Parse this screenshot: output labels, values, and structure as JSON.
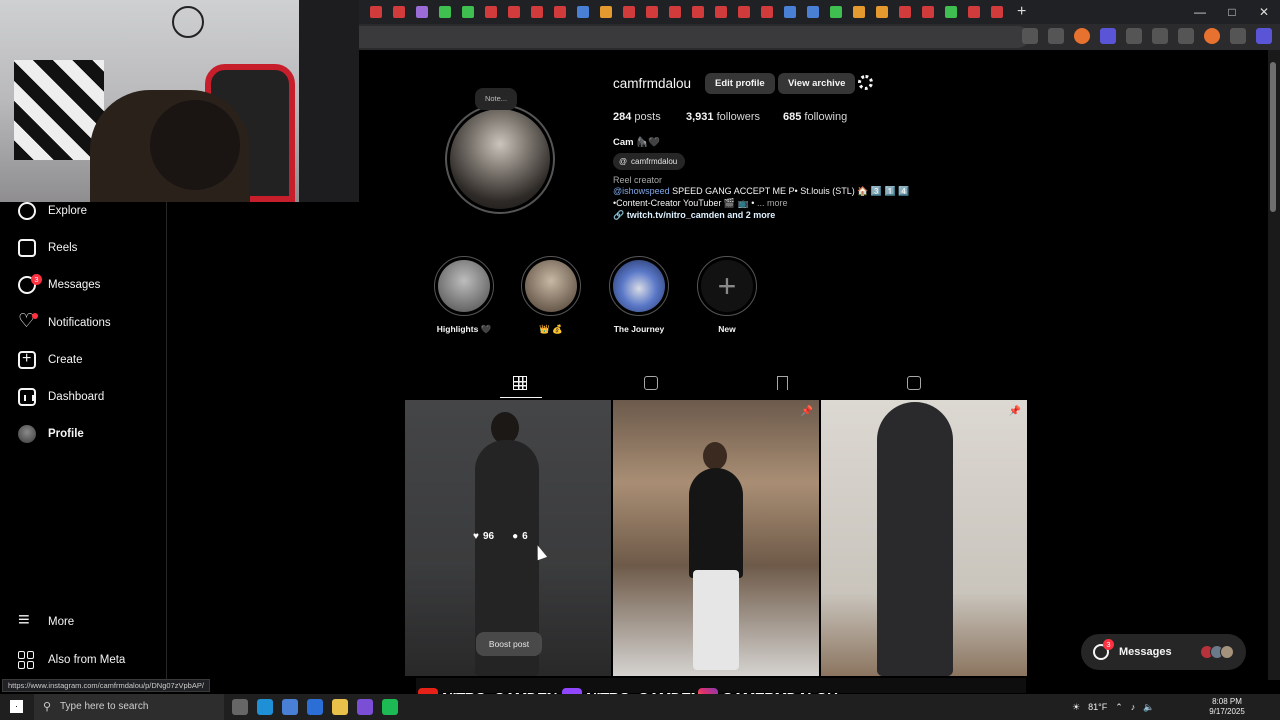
{
  "browser": {
    "window_controls": [
      "—",
      "□",
      "✕"
    ],
    "new_tab": "+"
  },
  "nav": {
    "items": [
      {
        "label": "Explore",
        "icon": "compass-icon"
      },
      {
        "label": "Reels",
        "icon": "reels-icon"
      },
      {
        "label": "Messages",
        "icon": "messenger-icon",
        "badge": "3"
      },
      {
        "label": "Notifications",
        "icon": "heart-icon"
      },
      {
        "label": "Create",
        "icon": "plus-icon"
      },
      {
        "label": "Dashboard",
        "icon": "dashboard-icon"
      },
      {
        "label": "Profile",
        "icon": "avatar"
      }
    ],
    "more": "More",
    "meta": "Also from Meta"
  },
  "profile": {
    "note": "Note...",
    "username": "camfrmdalou",
    "edit_profile": "Edit profile",
    "view_archive": "View archive",
    "posts_count": "284",
    "posts_label": "posts",
    "followers_count": "3,931",
    "followers_label": "followers",
    "following_count": "685",
    "following_label": "following",
    "full_name": "Cam 🦍🖤",
    "threads": "camfrmdalou",
    "category": "Reel creator",
    "bio_mention": "@ishowspeed",
    "bio_line1_rest": " SPEED GANG ACCEPT ME P• St.louis (STL) 🏠 3️⃣ 1️⃣ 4️⃣",
    "bio_line2": "•Content-Creator YouTuber 🎬 📺 •",
    "bio_more": " ... more",
    "link": "twitch.tv/nitro_camden and 2 more"
  },
  "highlights": [
    {
      "label": "Highlights 🖤",
      "color": "#6b6b6b"
    },
    {
      "label": "👑 💰",
      "color": "#6e5a4a"
    },
    {
      "label": "The Journey",
      "color": "#3b5aa0"
    },
    {
      "label": "New",
      "color": "#121212",
      "glyph": "+"
    }
  ],
  "posts": [
    {
      "likes": "96",
      "comments": "6",
      "boost": "Boost post"
    }
  ],
  "floating": {
    "messages_label": "Messages",
    "messages_badge": "3"
  },
  "status_url": "https://www.instagram.com/camfrmdalou/p/DNg07zVpbAP/",
  "stream": {
    "banner1": "NITRO_CAMDEN",
    "banner2": "NITRO_CAMDEN",
    "banner3": "CAMERMDALOU"
  },
  "taskbar": {
    "search": "Type here to search",
    "weather": "81°F",
    "time": "8:08 PM",
    "date": "9/17/2025"
  },
  "colors": {
    "accent_red": "#ff3040",
    "link_blue": "#7fa7e8",
    "button_bg": "#363636"
  }
}
